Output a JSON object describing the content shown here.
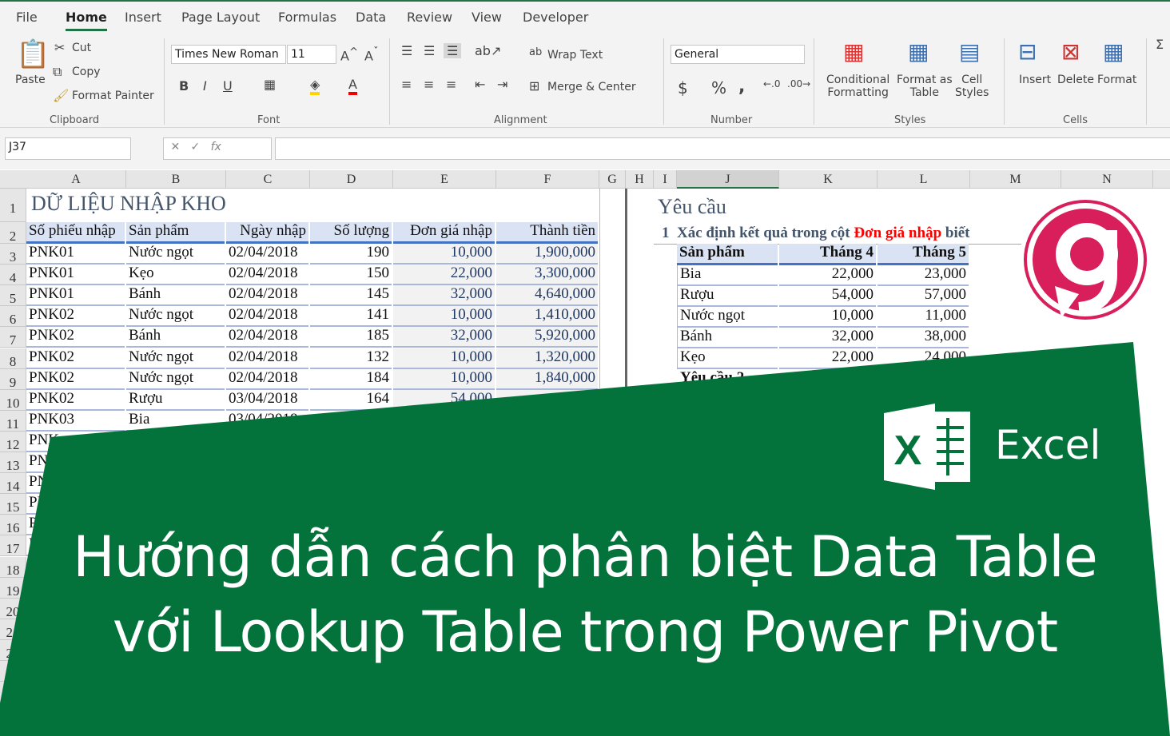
{
  "tabs": [
    "File",
    "Home",
    "Insert",
    "Page Layout",
    "Formulas",
    "Data",
    "Review",
    "View",
    "Developer"
  ],
  "ribbon": {
    "paste": "Paste",
    "cut": "Cut",
    "copy": "Copy",
    "format_painter": "Format Painter",
    "clipboard": "Clipboard",
    "font_name": "Times New Roman",
    "font_size": "11",
    "font": "Font",
    "wrap_text": "Wrap Text",
    "merge_center": "Merge & Center",
    "alignment": "Alignment",
    "number_format": "General",
    "number": "Number",
    "conditional_formatting": [
      "Conditional",
      "Formatting"
    ],
    "format_as_table": [
      "Format as",
      "Table"
    ],
    "cell_styles": [
      "Cell",
      "Styles"
    ],
    "styles": "Styles",
    "insert": "Insert",
    "delete": "Delete",
    "format": "Format",
    "cells": "Cells"
  },
  "formula_bar": {
    "name_box": "J37",
    "value": ""
  },
  "columns": [
    "A",
    "B",
    "C",
    "D",
    "E",
    "F",
    "G",
    "H",
    "I",
    "J",
    "K",
    "L",
    "M",
    "N"
  ],
  "left_table": {
    "title": "DỮ LIỆU NHẬP KHO",
    "headers": [
      "Số phiếu nhập",
      "Sản phẩm",
      "Ngày nhập",
      "Số lượng",
      "Đơn giá nhập",
      "Thành tiền"
    ],
    "rows": [
      [
        "PNK01",
        "Nước ngọt",
        "02/04/2018",
        "190",
        "10,000",
        "1,900,000"
      ],
      [
        "PNK01",
        "Kẹo",
        "02/04/2018",
        "150",
        "22,000",
        "3,300,000"
      ],
      [
        "PNK01",
        "Bánh",
        "02/04/2018",
        "145",
        "32,000",
        "4,640,000"
      ],
      [
        "PNK02",
        "Nước ngọt",
        "02/04/2018",
        "141",
        "10,000",
        "1,410,000"
      ],
      [
        "PNK02",
        "Bánh",
        "02/04/2018",
        "185",
        "32,000",
        "5,920,000"
      ],
      [
        "PNK02",
        "Nước ngọt",
        "02/04/2018",
        "132",
        "10,000",
        "1,320,000"
      ],
      [
        "PNK02",
        "Nước ngọt",
        "02/04/2018",
        "184",
        "10,000",
        "1,840,000"
      ],
      [
        "PNK02",
        "Rượu",
        "03/04/2018",
        "164",
        "54,000",
        ""
      ],
      [
        "PNK03",
        "Bia",
        "03/04/2018",
        "",
        "",
        ""
      ],
      [
        "PNK",
        "",
        "",
        "",
        "",
        ""
      ],
      [
        "PN",
        "",
        "",
        "",
        "",
        ""
      ],
      [
        "PN",
        "",
        "",
        "",
        "",
        ""
      ],
      [
        "PN",
        "",
        "",
        "",
        "",
        ""
      ],
      [
        "P",
        "",
        "",
        "",
        "",
        ""
      ],
      [
        "P",
        "",
        "",
        "",
        "",
        ""
      ]
    ]
  },
  "right": {
    "title": "Yêu cầu",
    "req_num": "1",
    "req_text": "Xác định kết quả trong cột ",
    "req_highlight": "Đơn giá nhập",
    "req_end": " biết",
    "headers": [
      "Sản phẩm",
      "Tháng 4",
      "Tháng 5"
    ],
    "rows": [
      [
        "Bia",
        "22,000",
        "23,000"
      ],
      [
        "Rượu",
        "54,000",
        "57,000"
      ],
      [
        "Nước ngọt",
        "10,000",
        "11,000"
      ],
      [
        "Bánh",
        "32,000",
        "38,000"
      ],
      [
        "Kẹo",
        "22,000",
        "24,000"
      ]
    ],
    "next": "Yêu cầu 2"
  },
  "banner": {
    "line1": "Hướng dẫn cách phân biệt Data Table",
    "line2": "với Lookup Table trong Power Pivot",
    "excel_label": "Excel",
    "logo_letter": "g"
  },
  "colors": {
    "excel_green": "#04733b",
    "logo": "#d81f5b"
  }
}
